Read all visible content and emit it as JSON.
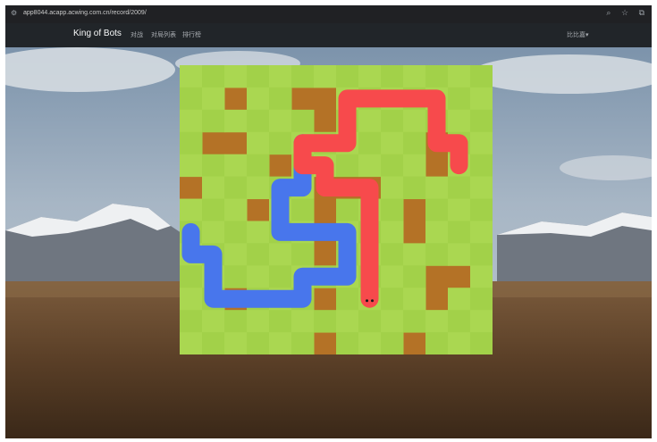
{
  "browser": {
    "url": "app8044.acapp.acwing.com.cn/record/2009/"
  },
  "navbar": {
    "brand": "King of Bots",
    "links": [
      "对战",
      "对局列表",
      "排行榜"
    ],
    "user": "比比嘉▾"
  },
  "game": {
    "rows": 13,
    "cols": 14,
    "walls": [
      [
        1,
        2
      ],
      [
        1,
        5
      ],
      [
        1,
        6
      ],
      [
        2,
        6
      ],
      [
        3,
        1
      ],
      [
        3,
        2
      ],
      [
        4,
        4
      ],
      [
        4,
        11
      ],
      [
        5,
        0
      ],
      [
        5,
        6
      ],
      [
        5,
        7
      ],
      [
        5,
        8
      ],
      [
        6,
        6
      ],
      [
        6,
        10
      ],
      [
        7,
        10
      ],
      [
        7,
        6
      ],
      [
        8,
        6
      ],
      [
        9,
        11
      ],
      [
        9,
        12
      ],
      [
        10,
        2
      ],
      [
        10,
        6
      ],
      [
        12,
        6
      ],
      [
        12,
        10
      ],
      [
        10,
        11
      ],
      [
        3,
        11
      ],
      [
        6,
        3
      ]
    ],
    "snakes": [
      {
        "name": "blue",
        "color": "#4876ec",
        "cells": [
          [
            3,
            5
          ],
          [
            4,
            5
          ],
          [
            5,
            5
          ],
          [
            5,
            4
          ],
          [
            6,
            4
          ],
          [
            7,
            4
          ],
          [
            7,
            5
          ],
          [
            7,
            6
          ],
          [
            7,
            7
          ],
          [
            8,
            7
          ],
          [
            9,
            7
          ],
          [
            9,
            6
          ],
          [
            9,
            5
          ],
          [
            10,
            5
          ],
          [
            10,
            4
          ],
          [
            10,
            3
          ],
          [
            10,
            2
          ],
          [
            10,
            1
          ],
          [
            9,
            1
          ],
          [
            8,
            1
          ],
          [
            8,
            0
          ],
          [
            7,
            0
          ]
        ]
      },
      {
        "name": "red",
        "color": "#f74a4c",
        "cells": [
          [
            10,
            8
          ],
          [
            9,
            8
          ],
          [
            8,
            8
          ],
          [
            7,
            8
          ],
          [
            6,
            8
          ],
          [
            5,
            8
          ],
          [
            5,
            7
          ],
          [
            5,
            6
          ],
          [
            4,
            6
          ],
          [
            4,
            5
          ],
          [
            3,
            5
          ],
          [
            3,
            6
          ],
          [
            3,
            7
          ],
          [
            2,
            7
          ],
          [
            1,
            7
          ],
          [
            1,
            8
          ],
          [
            1,
            9
          ],
          [
            1,
            10
          ],
          [
            1,
            11
          ],
          [
            2,
            11
          ],
          [
            3,
            11
          ],
          [
            3,
            12
          ],
          [
            4,
            12
          ]
        ]
      }
    ]
  },
  "colors": {
    "board": "#b47226",
    "grass_light": "#aad751",
    "grass_dark": "#a2d149"
  }
}
